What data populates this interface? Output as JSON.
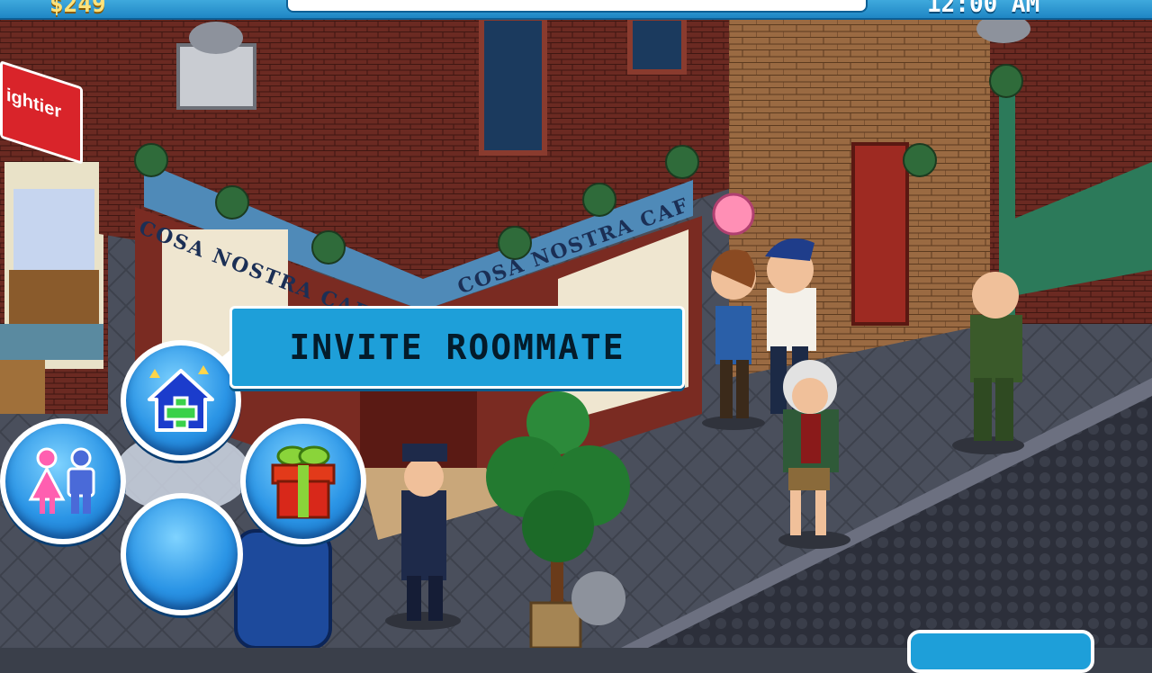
{
  "hud": {
    "money": "$249",
    "clock": "12:00 AM"
  },
  "tooltip": {
    "label": "INVITE ROOMMATE"
  },
  "signs": {
    "shop_left": "ightier",
    "cafe_left": "COSA NOSTRA CAFE",
    "cafe_right": "COSA NOSTRA CAFE"
  },
  "buttons": {
    "invite_icon": "house-plus-icon",
    "gender_icon": "couple-icon",
    "gift_icon": "gift-icon",
    "empty_icon": "blank-slot"
  },
  "colors": {
    "ui_blue": "#1e9fd9",
    "brick_red": "#6b2a22",
    "sidewalk": "#4a4f5c"
  }
}
